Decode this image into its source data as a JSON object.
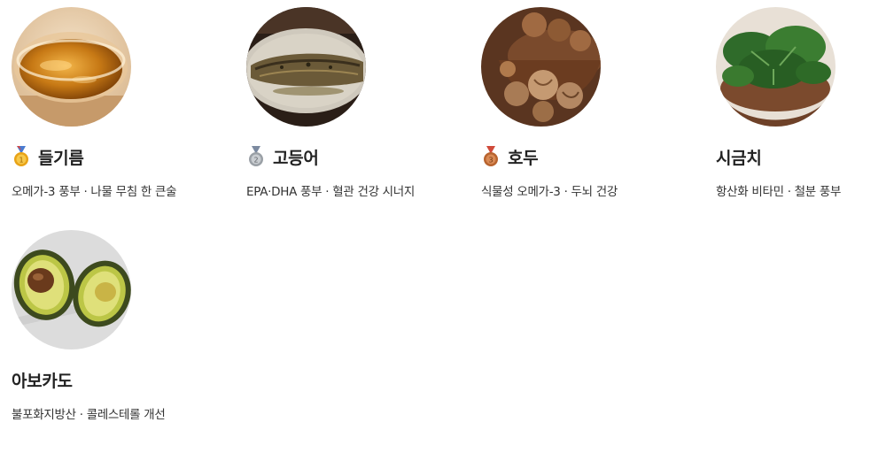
{
  "foods": [
    {
      "name": "들기름",
      "description": "오메가-3 풍부 · 나물 무침 한 큰술",
      "medal": "gold-medal-icon",
      "image": "perilla-oil-bowl-photo",
      "medal_color": "#E8A317"
    },
    {
      "name": "고등어",
      "description": "EPA·DHA 풍부 · 혈관 건강 시너지",
      "medal": "silver-medal-icon",
      "image": "grilled-mackerel-photo",
      "medal_color": "#9AA0A6"
    },
    {
      "name": "호두",
      "description": "식물성 오메가-3 · 두뇌 건강",
      "medal": "bronze-medal-icon",
      "image": "walnuts-bowl-photo",
      "medal_color": "#B8632E"
    },
    {
      "name": "시금치",
      "description": "항산화 비타민 · 철분 풍부",
      "medal": null,
      "image": "spinach-bowl-photo"
    },
    {
      "name": "아보카도",
      "description": "불포화지방산 · 콜레스테롤 개선",
      "medal": null,
      "image": "avocado-halves-photo"
    }
  ]
}
